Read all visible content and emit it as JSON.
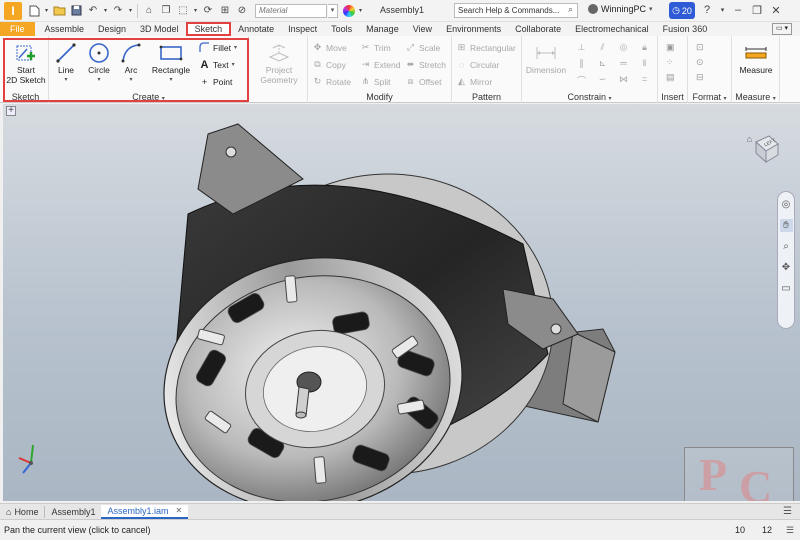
{
  "titlebar": {
    "app_letter": "I",
    "material_placeholder": "Material",
    "document_title": "Assembly1",
    "search_placeholder": "Search Help & Commands...",
    "user_name": "WinningPC",
    "clock_count": "20"
  },
  "ribbon_tabs": [
    {
      "label": "File"
    },
    {
      "label": "Assemble"
    },
    {
      "label": "Design"
    },
    {
      "label": "3D Model"
    },
    {
      "label": "Sketch"
    },
    {
      "label": "Annotate"
    },
    {
      "label": "Inspect"
    },
    {
      "label": "Tools"
    },
    {
      "label": "Manage"
    },
    {
      "label": "View"
    },
    {
      "label": "Environments"
    },
    {
      "label": "Collaborate"
    },
    {
      "label": "Electromechanical"
    },
    {
      "label": "Fusion 360"
    }
  ],
  "ribbon": {
    "sketch_panel": {
      "start_2d_sketch_line1": "Start",
      "start_2d_sketch_line2": "2D Sketch",
      "title": "Sketch"
    },
    "create_panel": {
      "line": "Line",
      "circle": "Circle",
      "arc": "Arc",
      "rectangle": "Rectangle",
      "fillet": "Fillet",
      "text": "Text",
      "point": "Point",
      "title": "Create"
    },
    "project_geometry_line1": "Project",
    "project_geometry_line2": "Geometry",
    "modify_panel": {
      "move": "Move",
      "trim": "Trim",
      "scale": "Scale",
      "copy": "Copy",
      "extend": "Extend",
      "stretch": "Stretch",
      "rotate": "Rotate",
      "split": "Split",
      "offset": "Offset",
      "title": "Modify"
    },
    "pattern_panel": {
      "rectangular": "Rectangular",
      "circular": "Circular",
      "mirror": "Mirror",
      "title": "Pattern"
    },
    "constrain_panel": {
      "dimension": "Dimension",
      "title": "Constrain"
    },
    "insert_title": "Insert",
    "format_title": "Format",
    "measure_panel": {
      "measure": "Measure",
      "title": "Measure"
    }
  },
  "viewport": {
    "viewcube_face": "LEFT",
    "watermark_letter1": "P",
    "watermark_letter2": "C"
  },
  "doc_tabs": [
    {
      "label": "Home"
    },
    {
      "label": "Assembly1"
    },
    {
      "label": "Assembly1.iam"
    }
  ],
  "statusbar": {
    "message": "Pan the current view (click to cancel)",
    "count_a": "10",
    "count_b": "12"
  },
  "colors": {
    "accent_orange": "#f5a623",
    "highlight_red": "#e34040",
    "active_blue": "#2a66c4"
  }
}
